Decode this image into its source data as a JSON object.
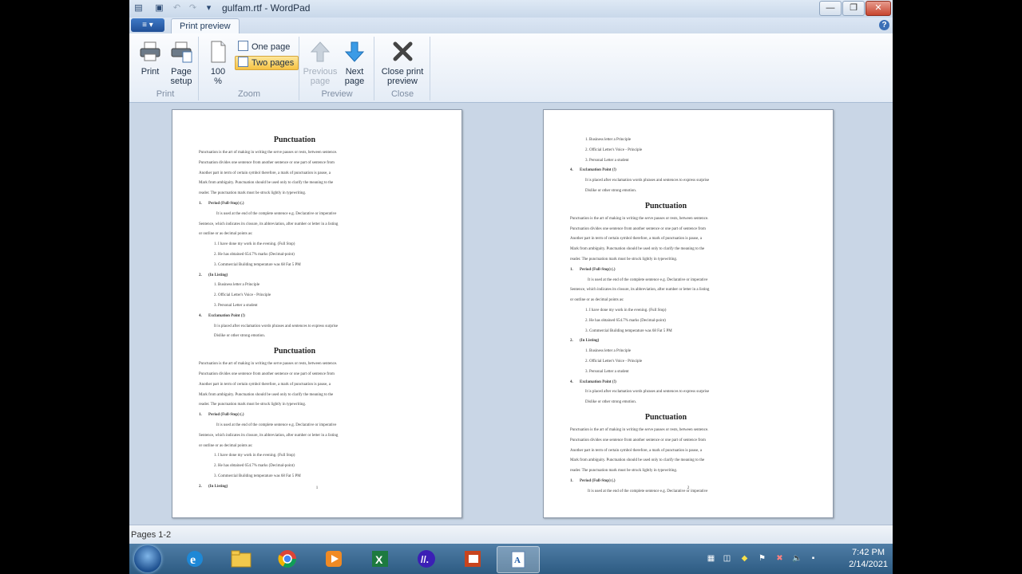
{
  "window": {
    "title": "gulfam.rtf - WordPad",
    "minimize": "—",
    "maximize": "❐",
    "close": "✕"
  },
  "tabs": {
    "app_menu": "≡ ▾",
    "print_preview": "Print preview",
    "help": "?"
  },
  "ribbon": {
    "print_group": {
      "label": "Print",
      "print": "Print",
      "page_setup_1": "Page",
      "page_setup_2": "setup"
    },
    "zoom_group": {
      "label": "Zoom",
      "zoom_value_1": "100",
      "zoom_value_2": "%",
      "one_page": "One page",
      "two_pages": "Two pages",
      "selected": "Two pages"
    },
    "preview_group": {
      "label": "Preview",
      "previous_1": "Previous",
      "previous_2": "page",
      "next_1": "Next",
      "next_2": "page"
    },
    "close_group": {
      "label": "Close",
      "close_1": "Close print",
      "close_2": "preview"
    }
  },
  "document": {
    "heading": "Punctuation",
    "para": [
      "Punctuation is the art of making in writing the serve pauses or rests, between sentence.",
      "Punctuation divides one sentence from another sentence or one part of sentence from",
      "Another part in term of certain symbol therefore, a mark of punctuation is  pause, a",
      "Mark from ambiguity. Punctuation should be used only to clarify the meaning to the",
      "reader. The punctuation mark must be struck lightly in typewriting."
    ],
    "period": {
      "n": "1.",
      "title": "Period (Full-Stop) (.)"
    },
    "period_desc": [
      "It is used at the end of the complete sentence e.g. Declarative or imperative",
      "Sentence, which indicates its closure, its abbreviation, after number or letter in a listing",
      "or outline or as decimal points as:"
    ],
    "period_items": [
      "1. I have done my work in the evening. (Full Stop)",
      "2. He has obtained 654.7% marks (Decimal-point)",
      "3. Commercial Building temperature was 68 Fat 5 PM"
    ],
    "listing": {
      "n": "2.",
      "title": "(In Listing)"
    },
    "listing_items": [
      "1. Business letter a Principle",
      "2. Official Letter's Voice - Principle",
      "3. Personal Letter a student"
    ],
    "exclamation": {
      "n": "4.",
      "title": "Exclamation Point (!)"
    },
    "exclamation_desc": [
      "It is placed after exclamation words phrases and sentences to express surprise",
      "Dislike or other strong emotion."
    ],
    "page1_number": "1",
    "page2_number": "2"
  },
  "status": {
    "pages": "Pages 1-2"
  },
  "taskbar": {
    "apps": [
      "Internet Explorer",
      "Windows Explorer",
      "Google Chrome",
      "Media Player",
      "Excel",
      "Adobe",
      "PowerPoint",
      "WordPad"
    ],
    "time": "7:42 PM",
    "date": "2/14/2021"
  },
  "colors": {
    "ribbon_selected": "#f6c244",
    "taskbar": "#2d5b82",
    "preview_bg": "#c9d6e6"
  }
}
